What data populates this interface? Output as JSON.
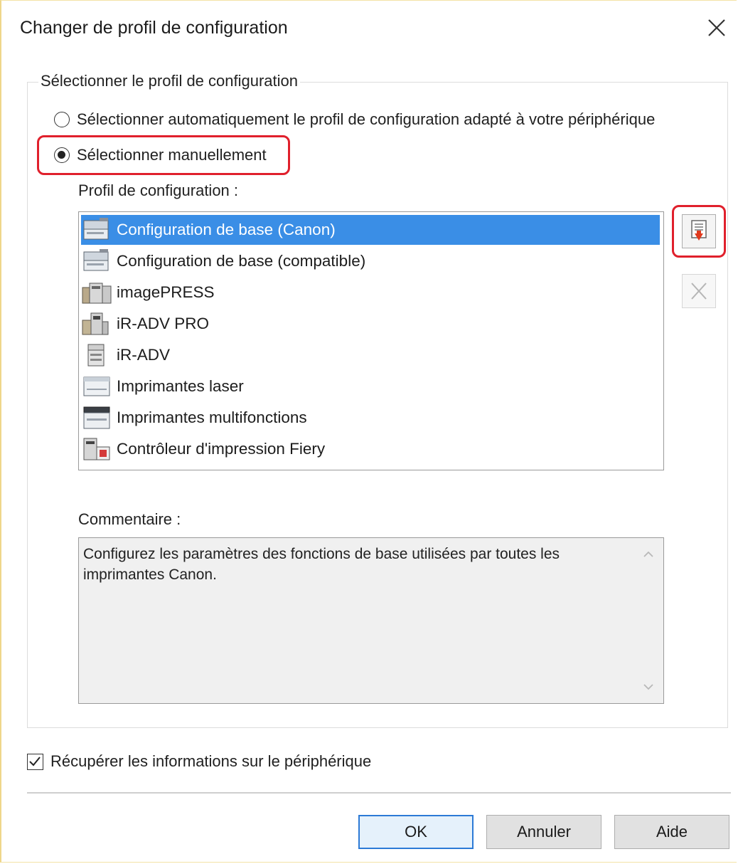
{
  "window": {
    "title": "Changer de profil de configuration",
    "close_icon": "close-icon"
  },
  "group": {
    "legend": "Sélectionner le profil de configuration",
    "radio_auto_label": "Sélectionner automatiquement le profil de configuration adapté à votre périphérique",
    "radio_manual_label": "Sélectionner manuellement",
    "selected_option": "manual"
  },
  "profile": {
    "label": "Profil de configuration :",
    "selected_index": 0,
    "items": [
      {
        "label": "Configuration de base (Canon)",
        "icon": "printer-icon"
      },
      {
        "label": "Configuration de base (compatible)",
        "icon": "printer-icon"
      },
      {
        "label": "imagePRESS",
        "icon": "production-printer-icon"
      },
      {
        "label": "iR-ADV PRO",
        "icon": "production-printer-icon"
      },
      {
        "label": "iR-ADV",
        "icon": "copier-icon"
      },
      {
        "label": "Imprimantes laser",
        "icon": "laser-printer-icon"
      },
      {
        "label": "Imprimantes multifonctions",
        "icon": "multifunction-printer-icon"
      },
      {
        "label": "Contrôleur d'impression Fiery",
        "icon": "fiery-controller-icon"
      }
    ]
  },
  "side_buttons": {
    "import_icon": "import-profile-icon",
    "delete_icon": "delete-profile-icon"
  },
  "comment": {
    "label": "Commentaire :",
    "text": "Configurez les paramètres des fonctions de base utilisées par toutes les imprimantes Canon."
  },
  "checkbox": {
    "label": "Récupérer les informations sur le périphérique",
    "checked": true
  },
  "buttons": {
    "ok": "OK",
    "cancel": "Annuler",
    "help": "Aide"
  },
  "colors": {
    "selection": "#3a8ee6",
    "highlight": "#e0202c",
    "default_button_border": "#2c7ad6"
  }
}
